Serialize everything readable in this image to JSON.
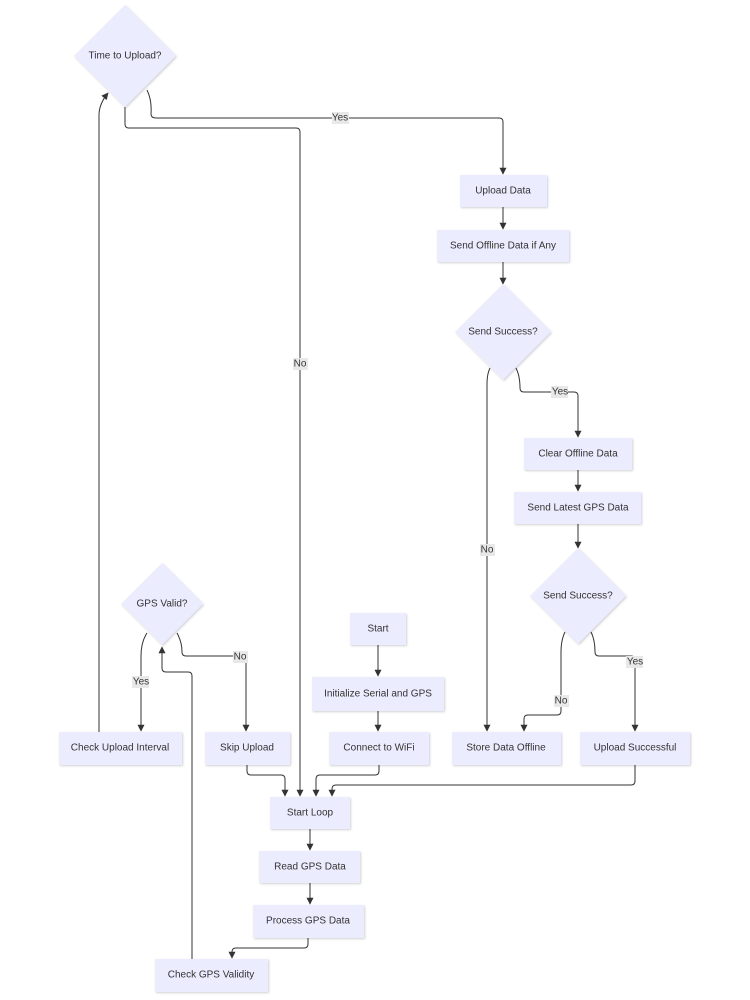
{
  "nodes": {
    "time_to_upload": "Time to Upload?",
    "upload_data": "Upload Data",
    "send_offline": "Send Offline Data if Any",
    "send_success_1": "Send Success?",
    "clear_offline": "Clear Offline Data",
    "send_latest": "Send Latest GPS Data",
    "send_success_2": "Send Success?",
    "gps_valid": "GPS Valid?",
    "start": "Start",
    "init_serial": "Initialize Serial and GPS",
    "check_upload_interval": "Check Upload Interval",
    "skip_upload": "Skip Upload",
    "connect_wifi": "Connect to WiFi",
    "store_offline": "Store Data Offline",
    "upload_successful": "Upload Successful",
    "start_loop": "Start Loop",
    "read_gps": "Read GPS Data",
    "process_gps": "Process GPS Data",
    "check_gps_validity": "Check GPS Validity"
  },
  "edge_labels": {
    "time_yes": "Yes",
    "time_no": "No",
    "success1_yes": "Yes",
    "success1_no": "No",
    "success2_no": "No",
    "success2_yes": "Yes",
    "gps_yes": "Yes",
    "gps_no": "No"
  },
  "colors": {
    "node_fill": "#ececff",
    "edge": "#333333",
    "label_bg": "#e8e8e8"
  }
}
